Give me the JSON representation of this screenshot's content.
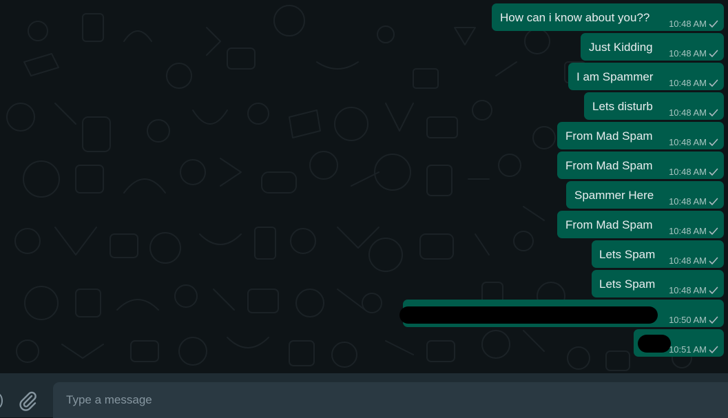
{
  "colors": {
    "chat_background": "#0e1417",
    "outgoing_bubble": "#005c4b",
    "composer_background": "#1f2c33",
    "input_background": "#2a3942",
    "message_text": "#e9edef",
    "meta_text": "#aebac1",
    "icon": "#8696a0"
  },
  "messages": [
    {
      "text": "How can i know about you??",
      "time": "10:48 AM",
      "status_icon": "single-check-icon"
    },
    {
      "text": "Just Kidding",
      "time": "10:48 AM",
      "status_icon": "single-check-icon"
    },
    {
      "text": "I am Spammer",
      "time": "10:48 AM",
      "status_icon": "single-check-icon"
    },
    {
      "text": "Lets disturb",
      "time": "10:48 AM",
      "status_icon": "single-check-icon"
    },
    {
      "text": "From Mad Spam",
      "time": "10:48 AM",
      "status_icon": "single-check-icon"
    },
    {
      "text": "From Mad Spam",
      "time": "10:48 AM",
      "status_icon": "single-check-icon"
    },
    {
      "text": "Spammer Here",
      "time": "10:48 AM",
      "status_icon": "single-check-icon"
    },
    {
      "text": "From Mad Spam",
      "time": "10:48 AM",
      "status_icon": "single-check-icon"
    },
    {
      "text": "Lets Spam",
      "time": "10:48 AM",
      "status_icon": "single-check-icon"
    },
    {
      "text": "Lets Spam",
      "time": "10:48 AM",
      "status_icon": "single-check-icon"
    },
    {
      "text": "",
      "redacted": true,
      "time": "10:50 AM",
      "status_icon": "single-check-icon"
    },
    {
      "text": "",
      "redacted": true,
      "time": "10:51 AM",
      "status_icon": "single-check-icon"
    }
  ],
  "composer": {
    "placeholder": "Type a message",
    "value": "",
    "emoji_icon": "emoji-icon",
    "attach_icon": "paperclip-icon"
  }
}
